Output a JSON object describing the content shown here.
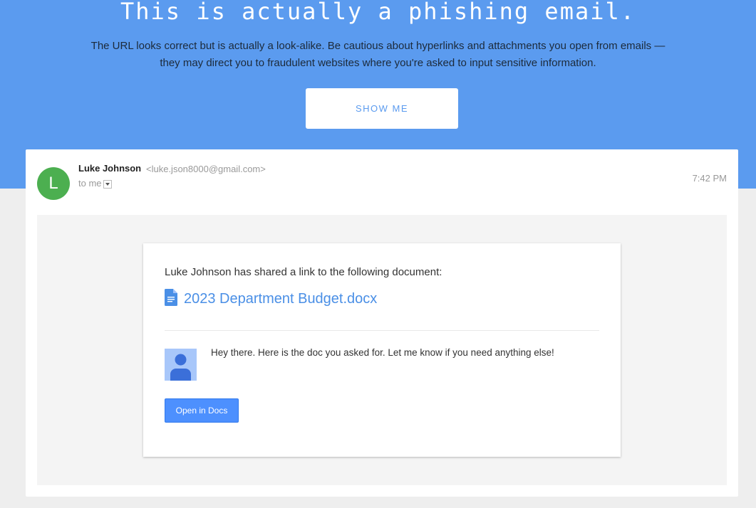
{
  "hero": {
    "title": "This is actually a phishing email.",
    "description_line1": "The URL looks correct but is actually a look-alike. Be cautious about hyperlinks and attachments you open from emails —",
    "description_line2": "they may direct you to fraudulent websites where you're asked to input sensitive information.",
    "button_label": "SHOW ME",
    "background_color": "#5b9bef"
  },
  "email": {
    "avatar_letter": "L",
    "avatar_color": "#4caf50",
    "sender_name": "Luke Johnson",
    "sender_email": "<luke.json8000@gmail.com>",
    "recipient": "to me",
    "time": "7:42 PM",
    "dropdown_icon": "chevron-down-icon"
  },
  "share_card": {
    "share_text": "Luke Johnson has shared a link to the following document:",
    "doc_icon": "google-docs-icon",
    "doc_name": "2023 Department Budget.docx",
    "sharer_avatar_icon": "person-icon",
    "message": "Hey there. Here is the doc you asked for. Let me know if you need anything else!",
    "button_label": "Open in Docs",
    "button_color": "#4d90fe",
    "link_color": "#4a8fe6"
  }
}
